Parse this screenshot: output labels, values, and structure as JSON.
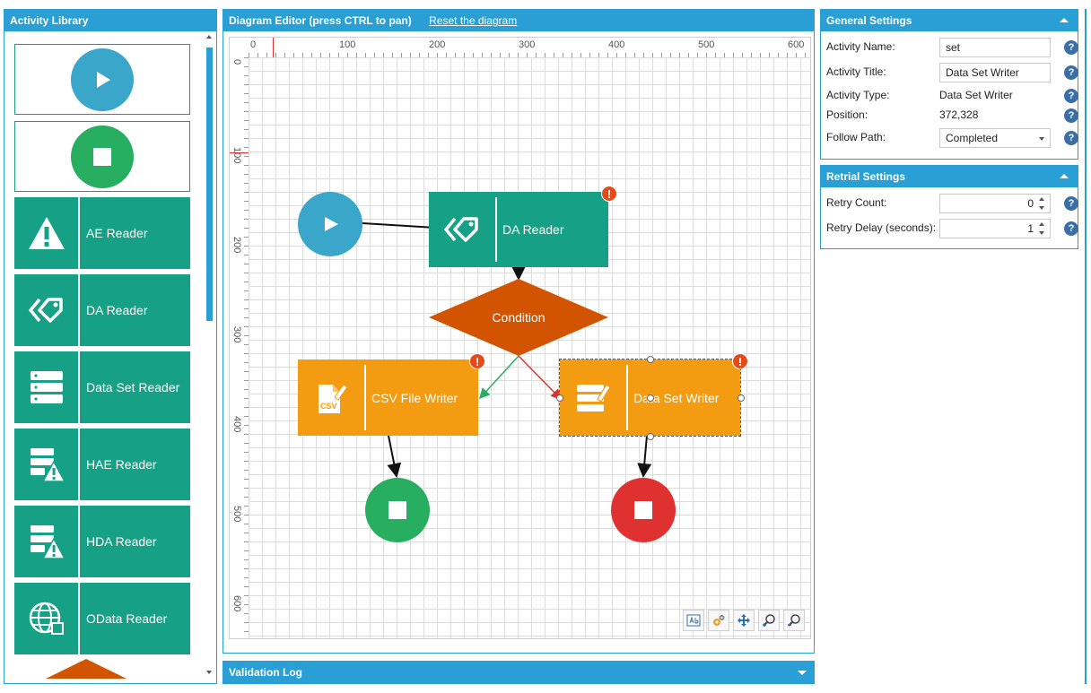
{
  "library": {
    "title": "Activity Library",
    "items": [
      {
        "label": "AE Reader",
        "icon": "warning-icon"
      },
      {
        "label": "DA Reader",
        "icon": "tag-icon"
      },
      {
        "label": "Data Set Reader",
        "icon": "dataset-icon"
      },
      {
        "label": "HAE Reader",
        "icon": "hae-icon"
      },
      {
        "label": "HDA Reader",
        "icon": "hda-icon"
      },
      {
        "label": "OData Reader",
        "icon": "globe-icon"
      }
    ]
  },
  "editor": {
    "title": "Diagram Editor (press CTRL to pan)",
    "reset_link": "Reset the diagram",
    "ruler_top": [
      "0",
      "100",
      "200",
      "300",
      "400",
      "500",
      "600"
    ],
    "ruler_left": [
      "0",
      "100",
      "200",
      "300",
      "400",
      "500",
      "600"
    ],
    "nodes": {
      "da_reader": "DA Reader",
      "condition": "Condition",
      "csv_writer": "CSV File Writer",
      "dataset_writer": "Data Set Writer",
      "warning_mark": "!",
      "csv_tag": "CSV"
    },
    "colors": {
      "teal": "#16a085",
      "orange": "#f39c12",
      "condition": "#d35400",
      "start": "#3aa6c9",
      "end_ok": "#27ae60",
      "end_fail": "#e03131"
    }
  },
  "validation": {
    "title": "Validation Log"
  },
  "general": {
    "title": "General Settings",
    "activity_name_label": "Activity Name:",
    "activity_name_value": "set",
    "activity_title_label": "Activity Title:",
    "activity_title_value": "Data Set Writer",
    "activity_type_label": "Activity Type:",
    "activity_type_value": "Data Set Writer",
    "position_label": "Position:",
    "position_value": "372,328",
    "follow_path_label": "Follow Path:",
    "follow_path_value": "Completed",
    "help_mark": "?"
  },
  "retrial": {
    "title": "Retrial Settings",
    "retry_count_label": "Retry Count:",
    "retry_count_value": "0",
    "retry_delay_label": "Retry Delay (seconds):",
    "retry_delay_value": "1"
  }
}
